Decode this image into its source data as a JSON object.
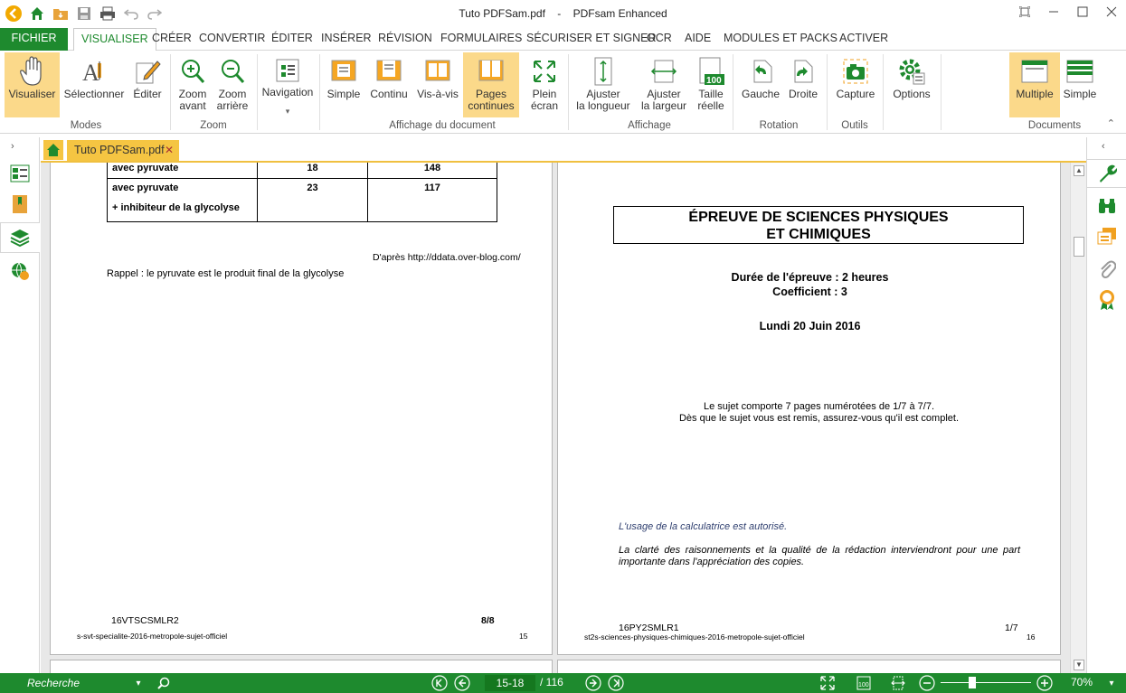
{
  "window": {
    "doc_name": "Tuto PDFSam.pdf",
    "separator": "-",
    "app_name": "PDFsam Enhanced"
  },
  "menu": {
    "fichier": "FICHIER",
    "tabs": [
      "VISUALISER",
      "CRÉER",
      "CONVERTIR",
      "ÉDITER",
      "INSÉRER",
      "RÉVISION",
      "FORMULAIRES",
      "SÉCURISER ET SIGNER",
      "OCR",
      "AIDE",
      "MODULES ET PACKS",
      "ACTIVER"
    ],
    "active": "VISUALISER"
  },
  "ribbon": {
    "visualiser": "Visualiser",
    "selectionner": "Sélectionner",
    "editer": "Éditer",
    "zoom_avant": [
      "Zoom",
      "avant"
    ],
    "zoom_arriere": [
      "Zoom",
      "arrière"
    ],
    "navigation": "Navigation",
    "simple": "Simple",
    "continu": "Continu",
    "vis_a_vis": "Vis-à-vis",
    "pages_continues": [
      "Pages",
      "continues"
    ],
    "plein_ecran": [
      "Plein",
      "écran"
    ],
    "ajuster_longueur": [
      "Ajuster",
      "la longueur"
    ],
    "ajuster_largeur": [
      "Ajuster",
      "la largeur"
    ],
    "taille_reelle": [
      "Taille",
      "réelle"
    ],
    "taille_badge": "100",
    "gauche": "Gauche",
    "droite": "Droite",
    "capture": "Capture",
    "options": "Options",
    "multiple": "Multiple",
    "simple_doc": "Simple",
    "groups": {
      "modes": "Modes",
      "zoom": "Zoom",
      "affichage_document": "Affichage du document",
      "affichage": "Affichage",
      "rotation": "Rotation",
      "outils": "Outils",
      "documents": "Documents"
    }
  },
  "doctab": {
    "name": "Tuto PDFSam.pdf",
    "close": "✕"
  },
  "page_left": {
    "rows": [
      {
        "label": "avec pyruvate",
        "c1": "18",
        "c2": "148"
      },
      {
        "label": "avec pyruvate",
        "label2": "+ inhibiteur de la glycolyse",
        "c1": "23",
        "c2": "117"
      }
    ],
    "source": "D'après http://ddata.over-blog.com/",
    "rappel": "Rappel : le pyruvate est le produit final de la glycolyse",
    "code": "16VTSCSMLR2",
    "pagenum": "8/8",
    "footer_file": "s-svt-specialite-2016-metropole-sujet-officiel",
    "footer_num": "15"
  },
  "page_right": {
    "title1": "ÉPREUVE DE SCIENCES PHYSIQUES",
    "title2": "ET CHIMIQUES",
    "duree": "Durée de l'épreuve : 2 heures",
    "coef": "Coefficient : 3",
    "date": "Lundi 20 Juin 2016",
    "sujet1": "Le sujet comporte 7 pages numérotées de 1/7 à 7/7.",
    "sujet2": "Dès que le sujet vous est remis, assurez-vous qu'il est complet.",
    "calc": "L'usage de la calculatrice est autorisé.",
    "clarte": "La clarté des raisonnements et la qualité de la rédaction interviendront pour une part importante dans l'appréciation des copies.",
    "code": "16PY2SMLR1",
    "pagenum": "1/7",
    "footer_file": "st2s-sciences-physiques-chimiques-2016-metropole-sujet-officiel",
    "footer_num": "16"
  },
  "status": {
    "search_placeholder": "Recherche",
    "current_pages": "15-18",
    "total": "/ 116",
    "zoom": "70%",
    "zoom_level_pct": 35
  },
  "colors": {
    "accent": "#1e8a2e",
    "tab_gold": "#f5c542",
    "selected": "#fbd98a"
  }
}
